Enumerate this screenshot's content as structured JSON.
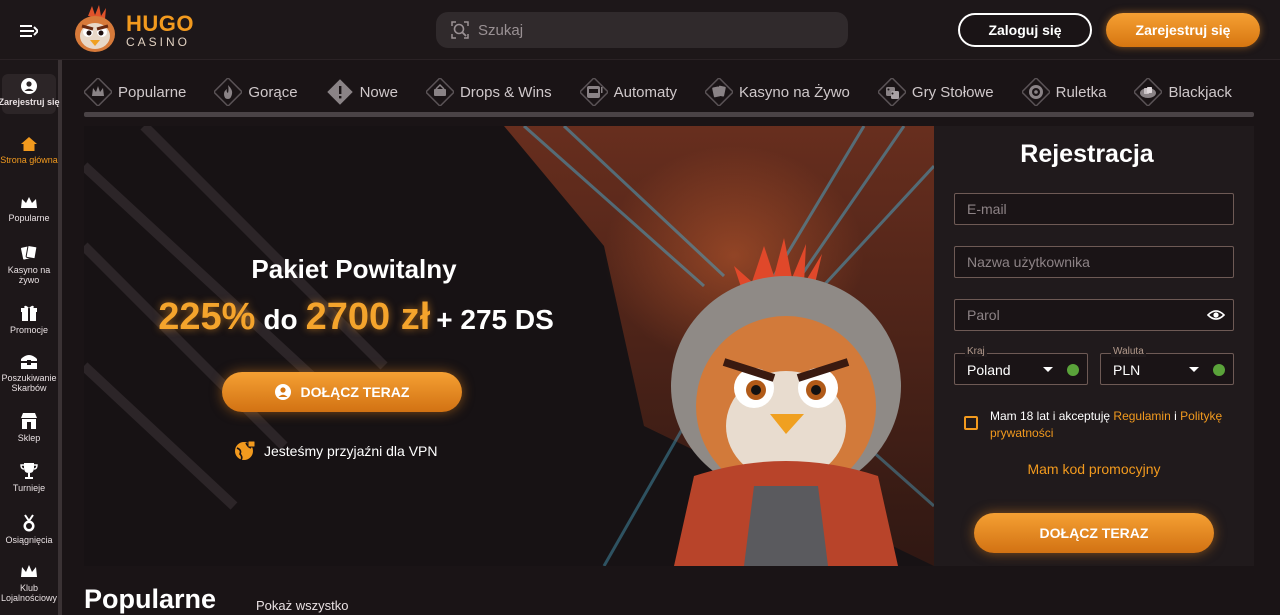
{
  "header": {
    "logo_top": "HUGO",
    "logo_bottom": "CASINO",
    "search_placeholder": "Szukaj",
    "login_label": "Zaloguj się",
    "register_label": "Zarejestruj się"
  },
  "sidebar": {
    "items": [
      {
        "label": "Zarejestruj się",
        "icon": "user-icon"
      },
      {
        "label": "Strona główna",
        "icon": "home-icon",
        "active": true
      },
      {
        "label": "Popularne",
        "icon": "crown-icon"
      },
      {
        "label": "Kasyno na żywo",
        "icon": "cards-icon"
      },
      {
        "label": "Promocje",
        "icon": "gift-icon"
      },
      {
        "label": "Poszukiwanie Skarbów",
        "icon": "treasure-chest-icon"
      },
      {
        "label": "Sklep",
        "icon": "shop-icon"
      },
      {
        "label": "Turnieje",
        "icon": "trophy-icon"
      },
      {
        "label": "Osiągnięcia",
        "icon": "medal-icon"
      },
      {
        "label": "Klub Lojalnościowy",
        "icon": "crown-loyalty-icon"
      }
    ]
  },
  "categories": [
    {
      "label": "Popularne",
      "icon": "crown-icon"
    },
    {
      "label": "Gorące",
      "icon": "flame-icon"
    },
    {
      "label": "Nowe",
      "icon": "exclamation-icon"
    },
    {
      "label": "Drops & Wins",
      "icon": "drops-wins-icon"
    },
    {
      "label": "Automaty",
      "icon": "slot-machine-icon"
    },
    {
      "label": "Kasyno na Żywo",
      "icon": "live-cards-icon"
    },
    {
      "label": "Gry Stołowe",
      "icon": "dice-icon"
    },
    {
      "label": "Ruletka",
      "icon": "roulette-icon"
    },
    {
      "label": "Blackjack",
      "icon": "blackjack-icon"
    }
  ],
  "banner": {
    "title": "Pakiet Powitalny",
    "percent": "225%",
    "connector": "do",
    "amount": "2700 zł",
    "extra": "+ 275 DS",
    "join_label": "DOŁĄCZ TERAZ",
    "vpn_text": "Jesteśmy przyjaźni dla VPN"
  },
  "registration": {
    "title": "Rejestracja",
    "email_placeholder": "E-mail",
    "username_placeholder": "Nazwa użytkownika",
    "password_placeholder": "Parol",
    "country_label": "Kraj",
    "country_value": "Poland",
    "currency_label": "Waluta",
    "currency_value": "PLN",
    "terms_prefix": "Mam 18 lat i akceptuję",
    "terms_link": "Regulamin",
    "terms_and": "i",
    "privacy_link": "Politykę prywatności",
    "promo_code_label": "Mam kod promocyjny",
    "join_label": "DOŁĄCZ TERAZ"
  },
  "section": {
    "title": "Popularne",
    "show_all": "Pokaż wszystko"
  },
  "colors": {
    "accent": "#f29a1e",
    "background": "#1a1416",
    "panel": "#201a1c",
    "valid": "#5aa33a"
  }
}
